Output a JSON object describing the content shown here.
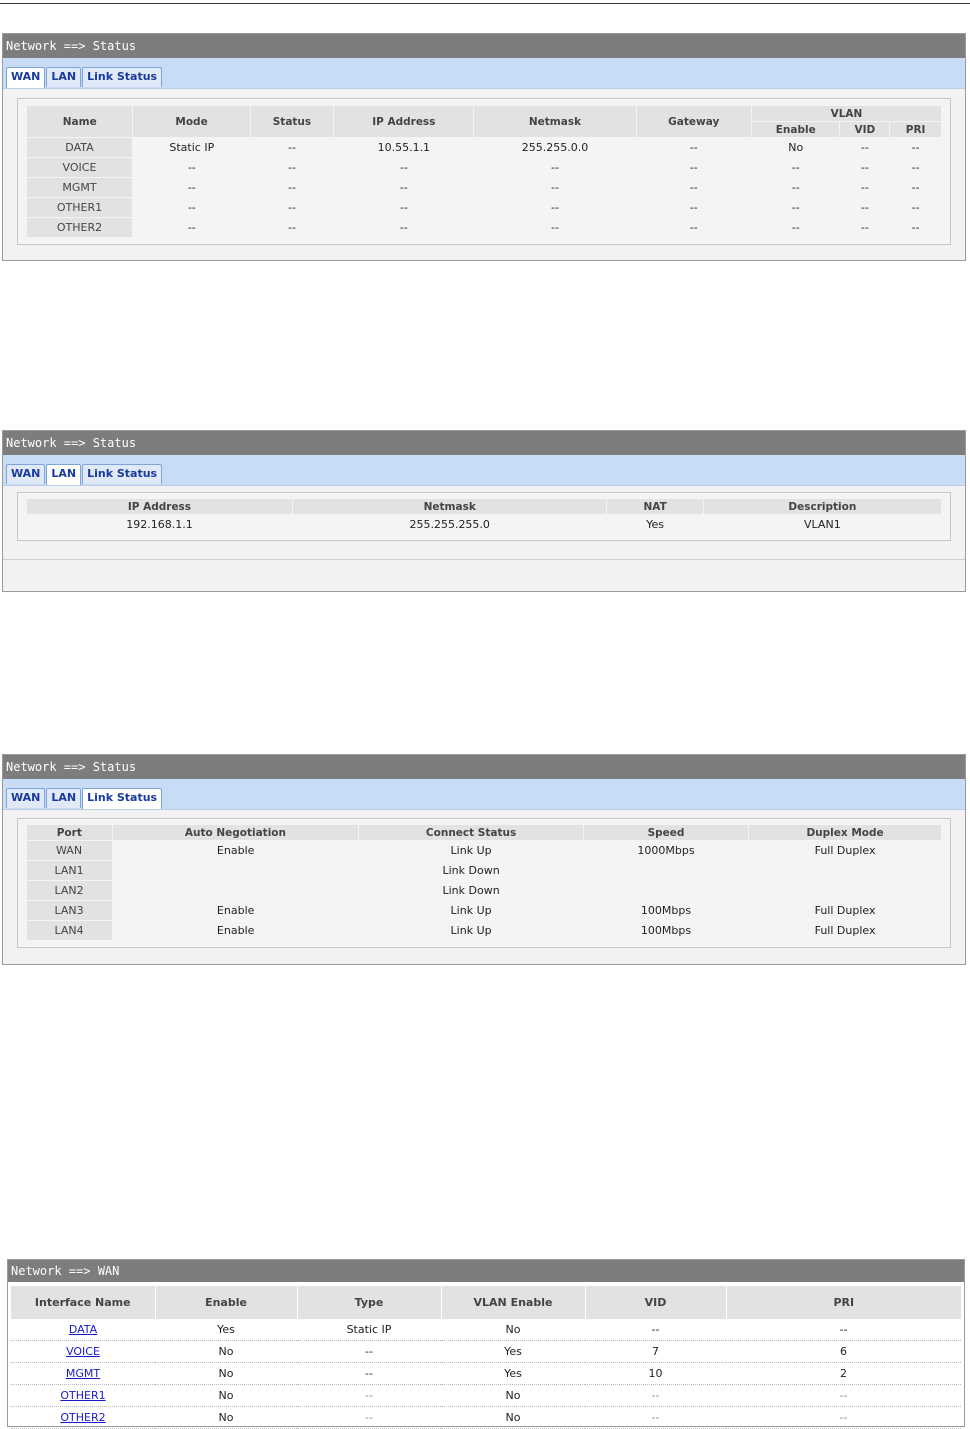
{
  "top_rule": "",
  "panel1": {
    "title": "Network ==> Status",
    "tabs": [
      "WAN",
      "LAN",
      "Link Status"
    ],
    "active_tab": 0,
    "headers": {
      "name": "Name",
      "mode": "Mode",
      "status": "Status",
      "ip": "IP Address",
      "netmask": "Netmask",
      "gateway": "Gateway",
      "vlan": "VLAN",
      "enable": "Enable",
      "vid": "VID",
      "pri": "PRI"
    },
    "rows": [
      [
        "DATA",
        "Static IP",
        "--",
        "10.55.1.1",
        "255.255.0.0",
        "--",
        "No",
        "--",
        "--"
      ],
      [
        "VOICE",
        "--",
        "--",
        "--",
        "--",
        "--",
        "--",
        "--",
        "--"
      ],
      [
        "MGMT",
        "--",
        "--",
        "--",
        "--",
        "--",
        "--",
        "--",
        "--"
      ],
      [
        "OTHER1",
        "--",
        "--",
        "--",
        "--",
        "--",
        "--",
        "--",
        "--"
      ],
      [
        "OTHER2",
        "--",
        "--",
        "--",
        "--",
        "--",
        "--",
        "--",
        "--"
      ]
    ]
  },
  "panel2": {
    "title": "Network ==> Status",
    "tabs": [
      "WAN",
      "LAN",
      "Link Status"
    ],
    "active_tab": 1,
    "headers": [
      "IP Address",
      "Netmask",
      "NAT",
      "Description"
    ],
    "rows": [
      [
        "192.168.1.1",
        "255.255.255.0",
        "Yes",
        "VLAN1"
      ]
    ]
  },
  "panel3": {
    "title": "Network ==> Status",
    "tabs": [
      "WAN",
      "LAN",
      "Link Status"
    ],
    "active_tab": 2,
    "headers": [
      "Port",
      "Auto Negotiation",
      "Connect Status",
      "Speed",
      "Duplex Mode"
    ],
    "rows": [
      [
        "WAN",
        "Enable",
        "Link Up",
        "1000Mbps",
        "Full Duplex"
      ],
      [
        "LAN1",
        "",
        "Link Down",
        "",
        ""
      ],
      [
        "LAN2",
        "",
        "Link Down",
        "",
        ""
      ],
      [
        "LAN3",
        "Enable",
        "Link Up",
        "100Mbps",
        "Full Duplex"
      ],
      [
        "LAN4",
        "Enable",
        "Link Up",
        "100Mbps",
        "Full Duplex"
      ]
    ]
  },
  "panel4": {
    "title": "Network ==> WAN",
    "headers": [
      "Interface Name",
      "Enable",
      "Type",
      "VLAN Enable",
      "VID",
      "PRI"
    ],
    "rows": [
      [
        "DATA",
        "Yes",
        "Static IP",
        "No",
        "--",
        "--"
      ],
      [
        "VOICE",
        "No",
        "--",
        "Yes",
        "7",
        "6"
      ],
      [
        "MGMT",
        "No",
        "--",
        "Yes",
        "10",
        "2"
      ],
      [
        "OTHER1",
        "No",
        "--",
        "No",
        "--",
        "--"
      ],
      [
        "OTHER2",
        "No",
        "--",
        "No",
        "--",
        "--"
      ]
    ]
  }
}
